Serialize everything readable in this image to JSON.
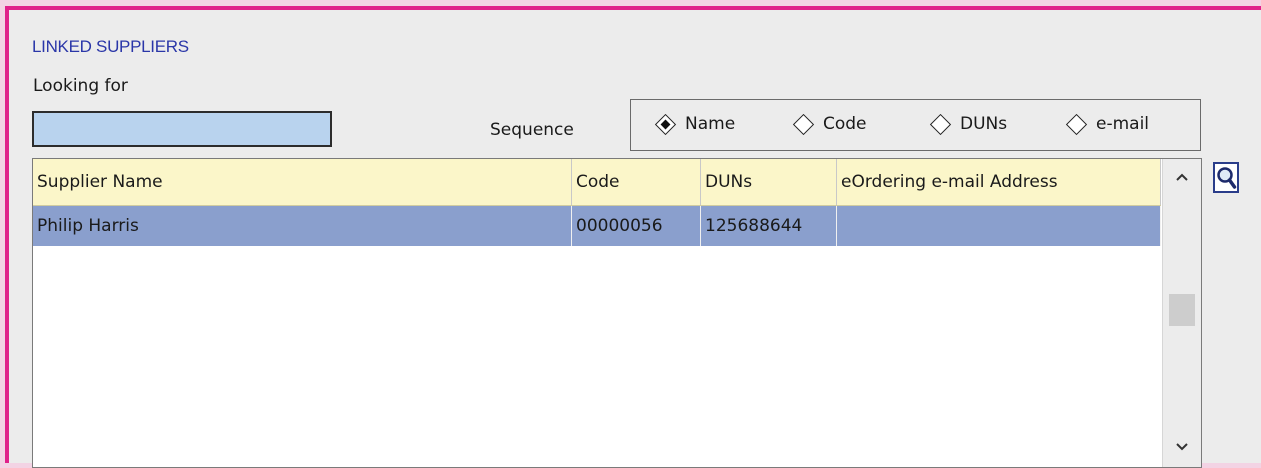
{
  "section_title": "LINKED SUPPLIERS",
  "search": {
    "label": "Looking for",
    "value": ""
  },
  "sequence": {
    "label": "Sequence",
    "options": [
      "Name",
      "Code",
      "DUNs",
      "e-mail"
    ],
    "selected": "Name"
  },
  "table": {
    "columns": [
      "Supplier Name",
      "Code",
      "DUNs",
      "eOrdering e-mail Address"
    ],
    "rows": [
      {
        "name": "Philip Harris",
        "code": "00000056",
        "duns": "125688644",
        "email": ""
      }
    ]
  },
  "scrollbar": {
    "up_icon": "chevron-up-icon",
    "down_icon": "chevron-down-icon"
  },
  "search_button_icon": "magnifier-icon",
  "colors": {
    "accent_border": "#e0218a",
    "title": "#2a36a8",
    "header_bg": "#fbf6c9",
    "selected_row_bg": "#8a9fcd",
    "input_bg": "#b9d3ee"
  }
}
